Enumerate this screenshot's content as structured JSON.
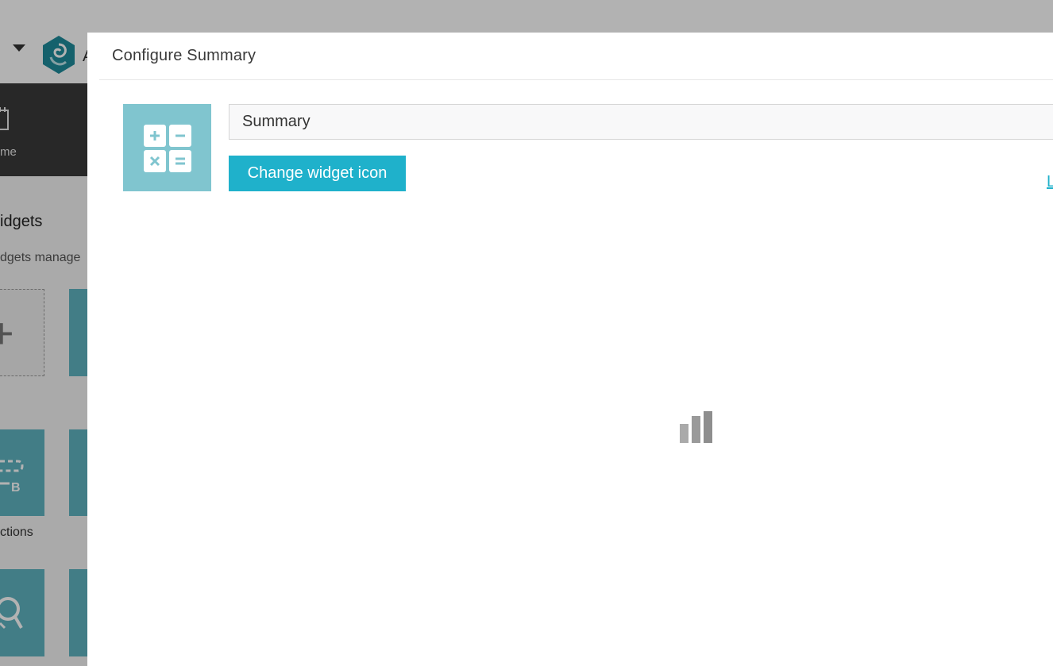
{
  "background": {
    "app_title_fragment": "A",
    "home_label_fragment": "me",
    "widgets_heading_fragment": "idgets",
    "widgets_sub_fragment": "dgets manage",
    "add_widget_glyph": "+",
    "tile_label_fragment": "ctions"
  },
  "modal": {
    "title": "Configure Summary",
    "name_value": "Summary",
    "change_icon_label": "Change widget icon",
    "link_fragment": "L",
    "preview_icon": "calculator-icon"
  },
  "colors": {
    "accent": "#1fb1cb",
    "icon_preview_bg": "#80c5cf",
    "tile_bg": "#5fb3c0"
  }
}
